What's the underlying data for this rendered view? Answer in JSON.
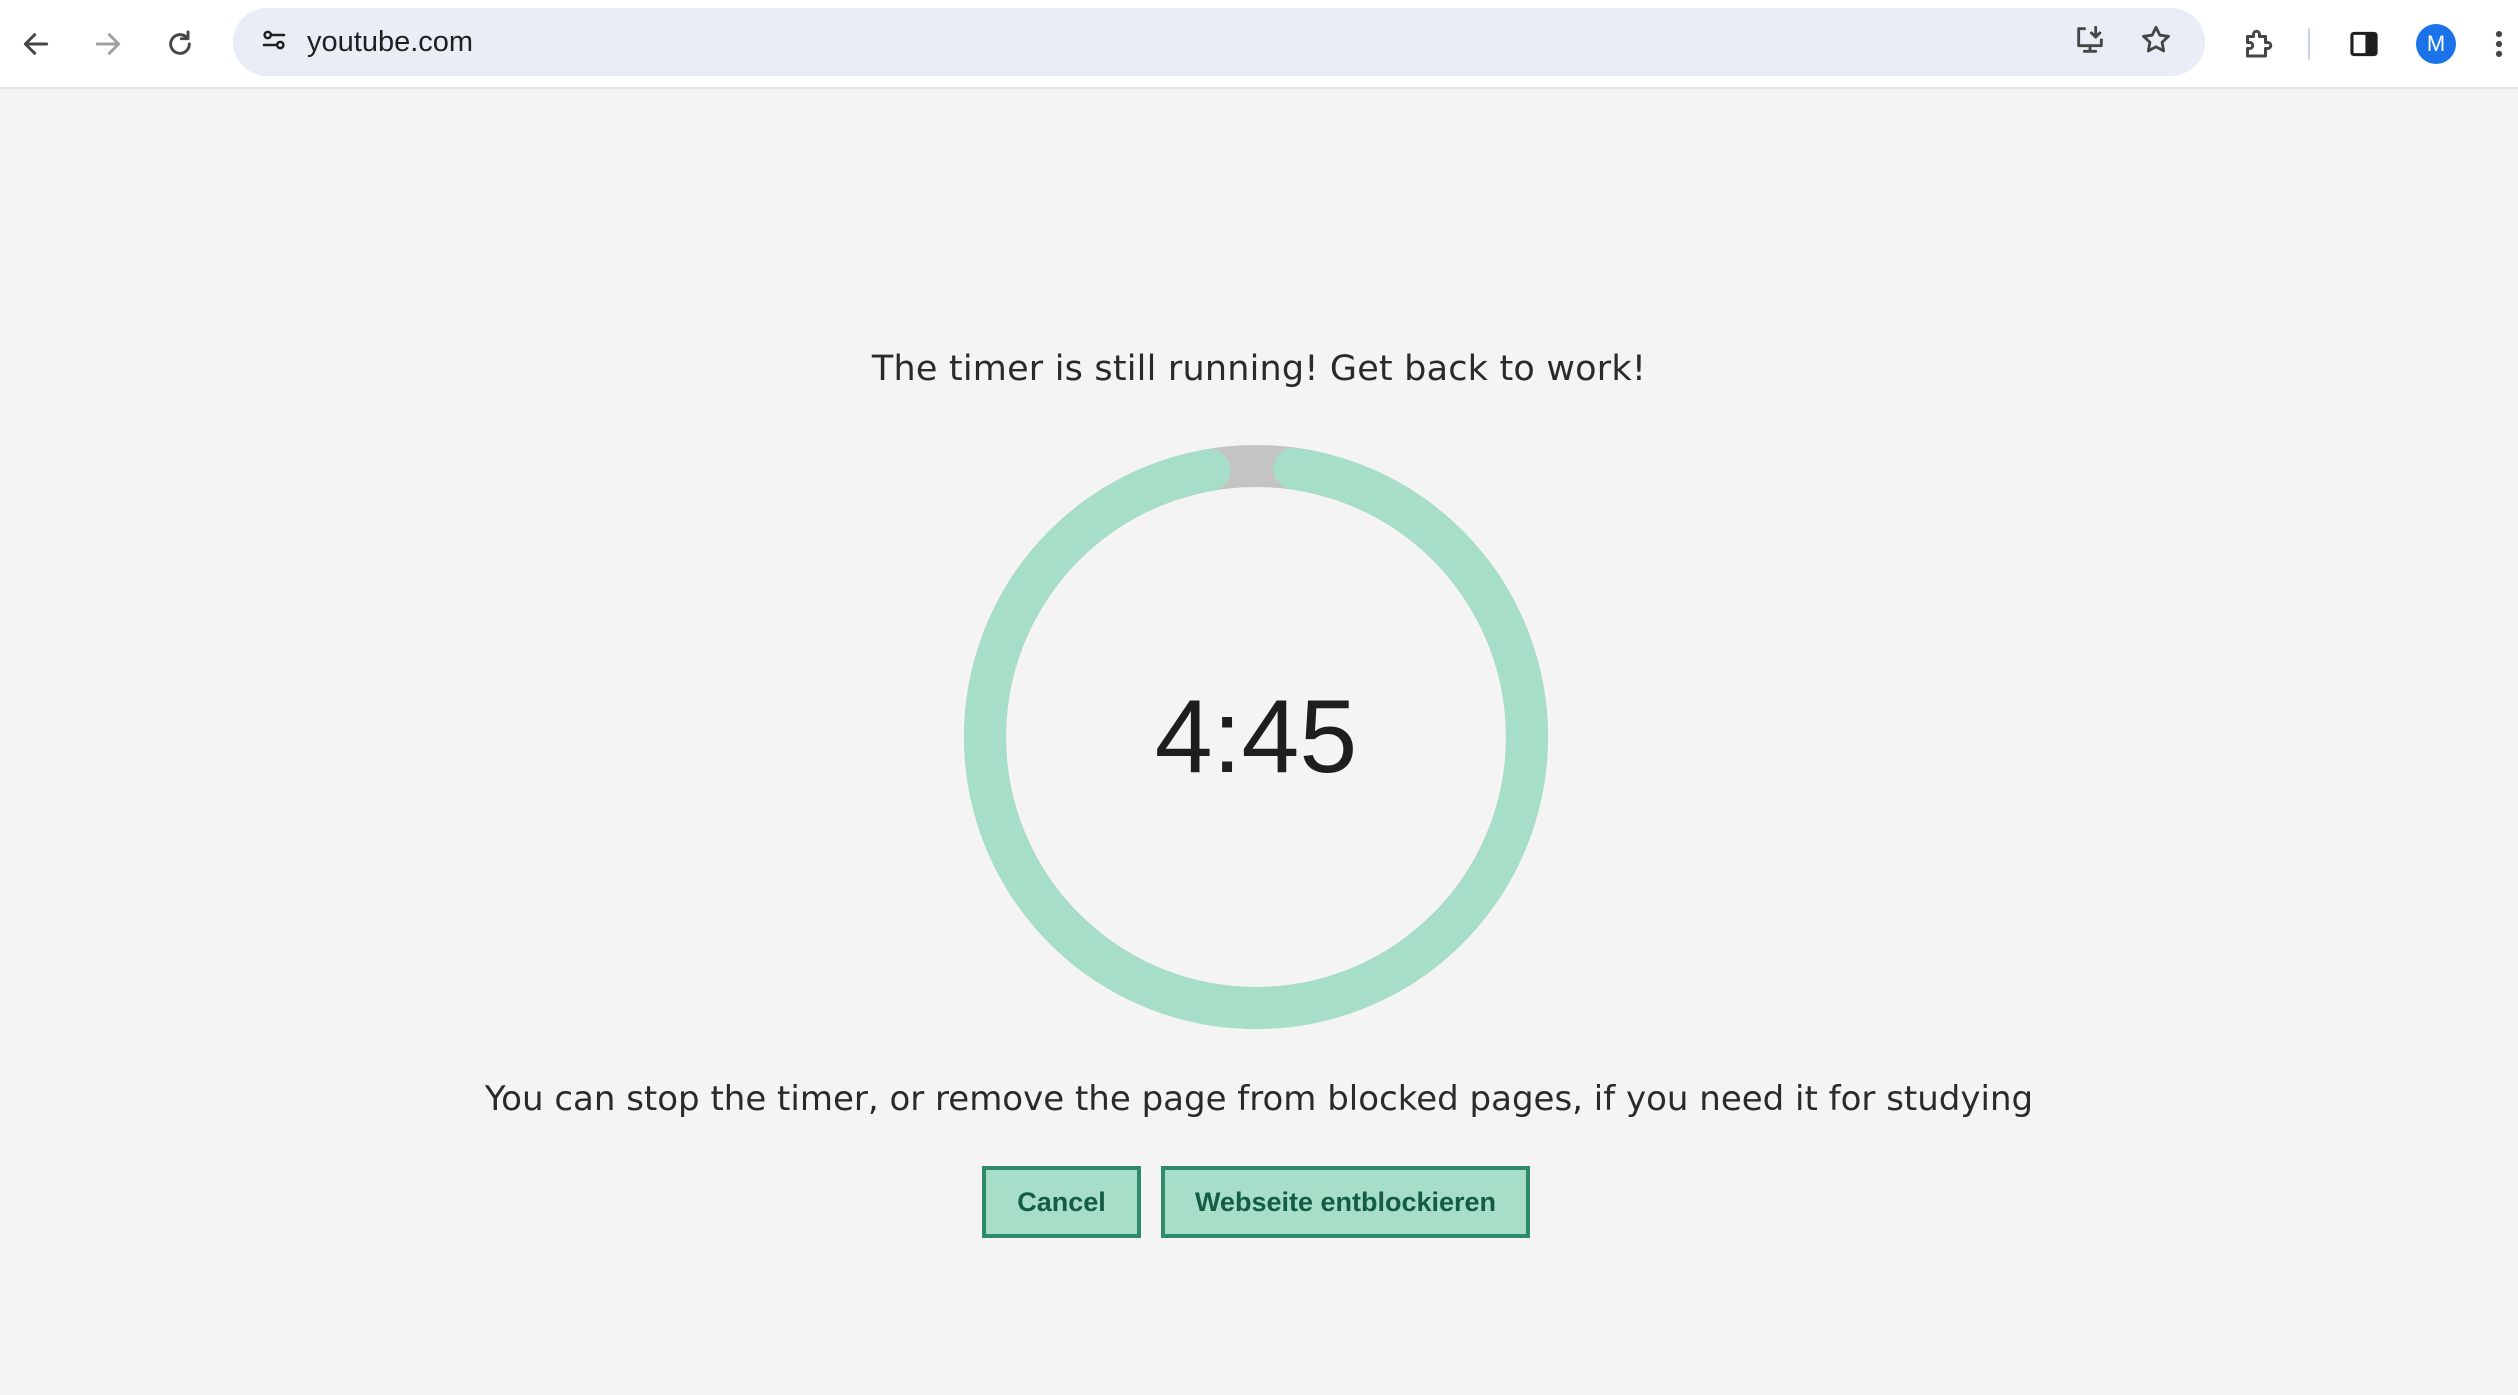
{
  "browser": {
    "url": "youtube.com",
    "profile_initial": "M",
    "icons": {
      "back": "back-arrow-icon",
      "forward": "forward-arrow-icon",
      "reload": "reload-icon",
      "site_info": "site-settings-icon",
      "install": "install-app-icon",
      "bookmark": "star-icon",
      "extensions": "puzzle-icon",
      "side_panel": "side-panel-icon",
      "menu": "kebab-menu-icon"
    }
  },
  "page": {
    "headline": "The timer is still running! Get back to work!",
    "timer": {
      "display": "4:45",
      "remaining_fraction": 0.95,
      "progress_color": "#a6dec8",
      "track_color": "#c4c4c4"
    },
    "subline": "You can stop the timer, or remove the page from blocked pages, if you need it for studying",
    "buttons": {
      "cancel": "Cancel",
      "unblock": "Webseite entblockieren"
    }
  }
}
